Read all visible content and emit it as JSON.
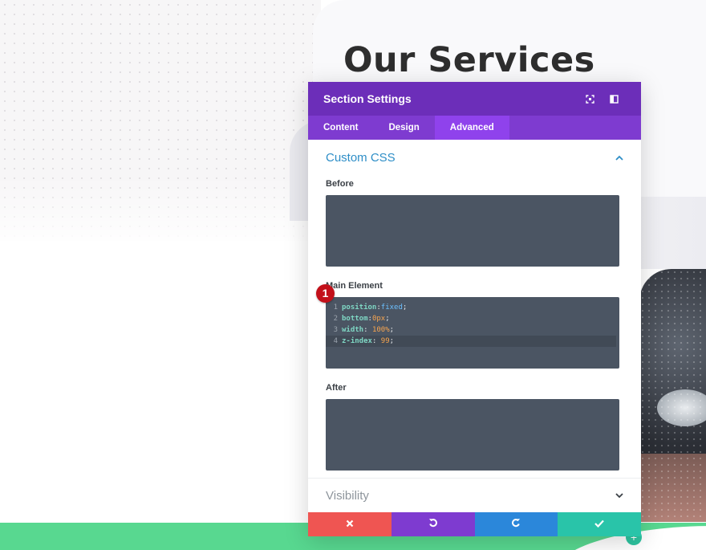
{
  "page": {
    "heading": "Our Services"
  },
  "modal": {
    "title": "Section Settings",
    "header_icons": [
      "expand-icon",
      "sidebar-toggle-icon"
    ],
    "tabs": [
      {
        "label": "Content",
        "active": false
      },
      {
        "label": "Design",
        "active": false
      },
      {
        "label": "Advanced",
        "active": true
      }
    ],
    "custom_css": {
      "title": "Custom CSS",
      "before": {
        "label": "Before",
        "value": ""
      },
      "main_element": {
        "label": "Main Element",
        "badge": "1",
        "lines": [
          {
            "num": "1",
            "prop": "position",
            "sep": ":",
            "value": "fixed",
            "end": ";"
          },
          {
            "num": "2",
            "prop": "bottom",
            "sep": ":",
            "value": "0px",
            "end": ";"
          },
          {
            "num": "3",
            "prop": "width",
            "sep": ": ",
            "value": "100%",
            "end": ";"
          },
          {
            "num": "4",
            "prop": "z-index",
            "sep": ": ",
            "value": "99",
            "end": ";"
          }
        ]
      },
      "after": {
        "label": "After",
        "value": ""
      }
    },
    "visibility": {
      "title": "Visibility"
    },
    "footer_buttons": [
      {
        "name": "discard-button",
        "icon": "close-icon",
        "color": "#ef5552"
      },
      {
        "name": "undo-button",
        "icon": "undo-icon",
        "color": "#7e3bd0"
      },
      {
        "name": "redo-button",
        "icon": "redo-icon",
        "color": "#2b87da"
      },
      {
        "name": "save-button",
        "icon": "check-icon",
        "color": "#29c4a9"
      }
    ]
  },
  "colors": {
    "header": "#6c2eb9",
    "tabs": "#7e3bd0",
    "tab_active": "#8f42ec",
    "accent_title": "#2e8ec7",
    "code_bg": "#4b5563",
    "badge": "#c3101a",
    "green_band": "#58d890"
  }
}
